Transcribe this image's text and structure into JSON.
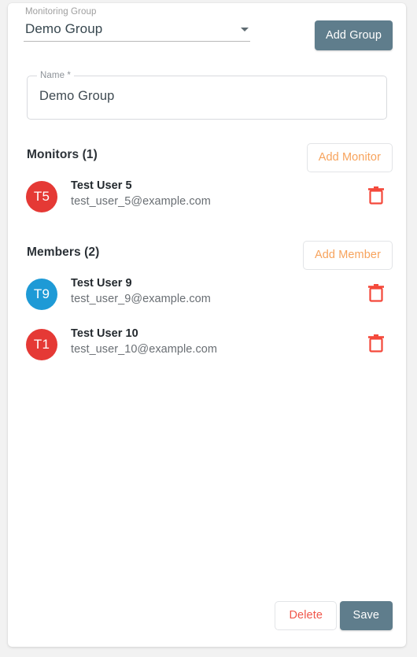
{
  "colors": {
    "card_bg": "#ffffff",
    "page_bg": "#f2f2f2",
    "primary_button": "#5f7d8c",
    "accent_orange": "#f7a35c",
    "danger_red": "#f0564a",
    "avatar_red": "#e53935",
    "avatar_blue": "#1e9ad6"
  },
  "group_select": {
    "label": "Monitoring Group",
    "value": "Demo Group",
    "arrow_icon": "chevron-down-icon"
  },
  "add_group_button": {
    "label": "Add Group"
  },
  "name_field": {
    "label": "Name *",
    "value": "Demo Group",
    "placeholder": ""
  },
  "monitors_section": {
    "title": "Monitors (1)",
    "count": 1,
    "action_label": "Add Monitor",
    "users": [
      {
        "initials": "T5",
        "avatar_color": "#e53935",
        "name": "Test User 5",
        "email": "test_user_5@example.com",
        "delete_icon": "trash-icon"
      }
    ]
  },
  "members_section": {
    "title": "Members (2)",
    "count": 2,
    "action_label": "Add Member",
    "users": [
      {
        "initials": "T9",
        "avatar_color": "#1e9ad6",
        "name": "Test User 9",
        "email": "test_user_9@example.com",
        "delete_icon": "trash-icon"
      },
      {
        "initials": "T1",
        "avatar_color": "#e53935",
        "name": "Test User 10",
        "email": "test_user_10@example.com",
        "delete_icon": "trash-icon"
      }
    ]
  },
  "footer": {
    "delete_label": "Delete",
    "save_label": "Save"
  }
}
